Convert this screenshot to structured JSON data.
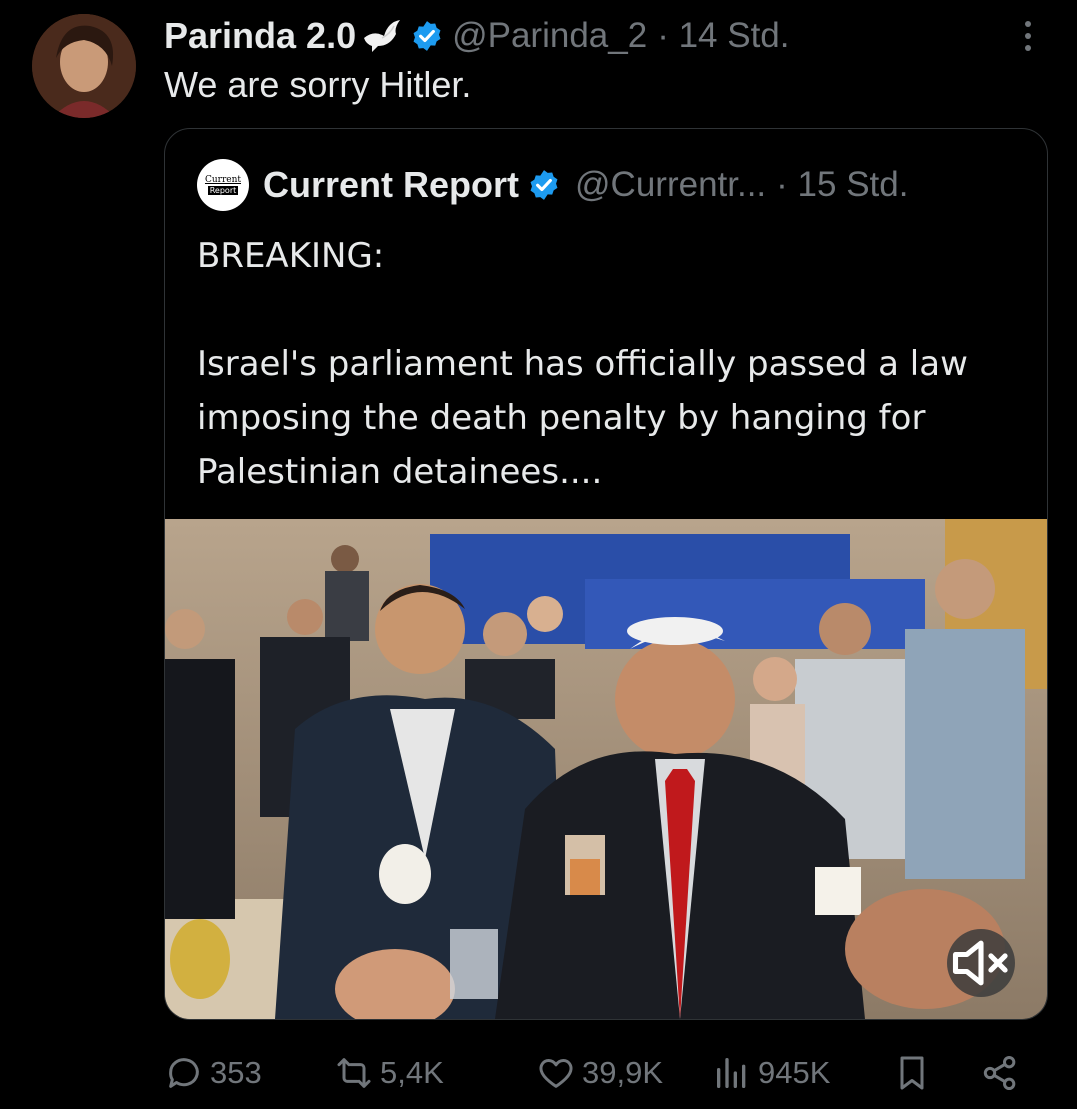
{
  "tweet": {
    "author_name": "Parinda 2.0",
    "handle": "@Parinda_2",
    "time": "· 14 Std.",
    "text": "We are sorry Hitler."
  },
  "quote": {
    "logo_line1": "Current",
    "logo_line2": "Report",
    "author_name": "Current Report",
    "handle": "@Currentr...",
    "time": "· 15 Std.",
    "text": "BREAKING:\n\nIsrael's parliament has officially passed a law imposing the death penalty by hanging for Palestinian detainees...."
  },
  "actions": {
    "replies": "353",
    "reposts": "5,4K",
    "likes": "39,9K",
    "views": "945K"
  },
  "icons": [
    "dove-icon",
    "verified-icon",
    "more-icon",
    "mute-icon",
    "reply-icon",
    "repost-icon",
    "like-icon",
    "views-icon",
    "bookmark-icon",
    "share-icon"
  ],
  "colors": {
    "background": "#000000",
    "text": "#e7e9ea",
    "muted": "#71767b",
    "verified": "#1d9bf0",
    "border": "#2f3336"
  }
}
